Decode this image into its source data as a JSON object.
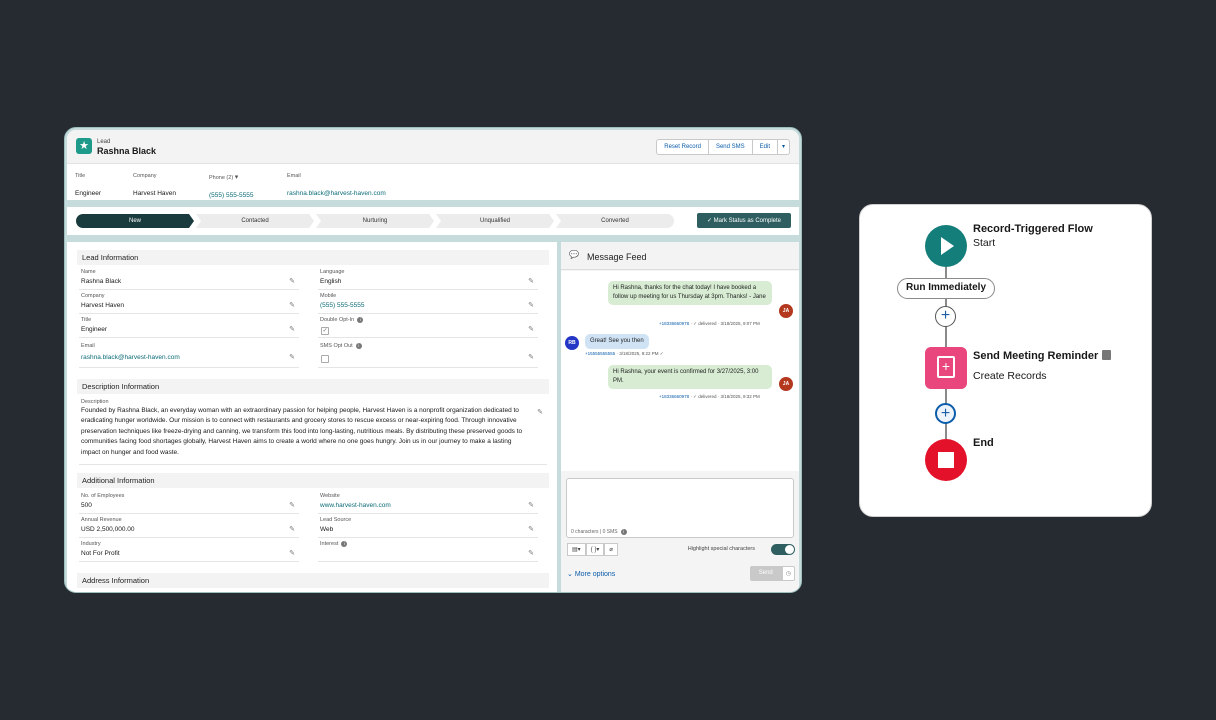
{
  "record": {
    "object_label": "Lead",
    "name": "Rashna Black",
    "actions": [
      "Reset Record",
      "Send SMS",
      "Edit"
    ],
    "highlights": [
      {
        "label": "Title",
        "value": "Engineer"
      },
      {
        "label": "Company",
        "value": "Harvest Haven"
      },
      {
        "label": "Phone (2)",
        "value": "(555) 555-5555"
      },
      {
        "label": "Email",
        "value": "rashna.black@harvest-haven.com"
      }
    ]
  },
  "path": {
    "steps": [
      "New",
      "Contacted",
      "Nurturing",
      "Unqualified",
      "Converted"
    ],
    "current": "New",
    "mark_button": "Mark Status as Complete"
  },
  "sections": {
    "lead_info": "Lead Information",
    "description_info": "Description Information",
    "additional_info": "Additional Information",
    "address_info": "Address Information"
  },
  "lead_fields": {
    "name": {
      "label": "Name",
      "value": "Rashna Black"
    },
    "company": {
      "label": "Company",
      "value": "Harvest Haven"
    },
    "title": {
      "label": "Title",
      "value": "Engineer"
    },
    "email": {
      "label": "Email",
      "value": "rashna.black@harvest-haven.com"
    },
    "language": {
      "label": "Language",
      "value": "English"
    },
    "mobile": {
      "label": "Mobile",
      "value": "(555) 555-5555"
    },
    "double_opt_in": {
      "label": "Double Opt-In",
      "checked": true
    },
    "sms_opt_out": {
      "label": "SMS Opt Out",
      "checked": false
    }
  },
  "description": {
    "label": "Description",
    "value": "Founded by Rashna Black, an everyday woman with an extraordinary passion for helping people, Harvest Haven is a nonprofit organization dedicated to eradicating hunger worldwide. Our mission is to connect with restaurants and grocery stores to rescue excess or near-expiring food. Through innovative preservation techniques like freeze-drying and canning, we transform this food into long-lasting, nutritious meals. By distributing these preserved goods to communities facing food shortages globally, Harvest Haven aims to create a world where no one goes hungry. Join us in our journey to make a lasting impact on hunger and food waste."
  },
  "additional_fields": {
    "employees": {
      "label": "No. of Employees",
      "value": "500"
    },
    "revenue": {
      "label": "Annual Revenue",
      "value": "USD 2,500,000.00"
    },
    "industry": {
      "label": "Industry",
      "value": "Not For Profit"
    },
    "website": {
      "label": "Website",
      "value": "www.harvest-haven.com"
    },
    "lead_source": {
      "label": "Lead Source",
      "value": "Web"
    },
    "interest": {
      "label": "Interest",
      "value": ""
    }
  },
  "feed": {
    "title": "Message Feed",
    "messages": [
      {
        "direction": "out",
        "text": "Hi Rashna, thanks for the chat today! I have booked a follow up meeting for us Thursday at 3pm. Thanks! - Jane",
        "number": "+18336660978",
        "status": "delivered",
        "time": "3/18/2025, 9:07 PM",
        "avatar": "JA"
      },
      {
        "direction": "in",
        "text": "Great! See you then",
        "number": "+15555555555",
        "time": "3/18/2025, 9:22 PM",
        "avatar": "RB"
      },
      {
        "direction": "out",
        "text": "Hi Rashna, your event is confirmed for 3/27/2025, 3:00 PM.",
        "number": "+18336660978",
        "status": "delivered",
        "time": "3/18/2025, 9:32 PM",
        "avatar": "JA"
      }
    ],
    "counter": "0 characters | 0 SMS",
    "highlight_label": "Highlight special characters",
    "highlight_on": true,
    "more_options": "More options",
    "send": "Send",
    "merge_field_glyph": "{ }"
  },
  "flow": {
    "trigger_title": "Record-Triggered Flow",
    "trigger_sub": "Start",
    "run_label": "Run Immediately",
    "action_title": "Send Meeting Reminder",
    "action_sub": "Create Records",
    "end_title": "End",
    "colors": {
      "start": "#137e7a",
      "action": "#e8467c",
      "end": "#e4112b"
    }
  }
}
